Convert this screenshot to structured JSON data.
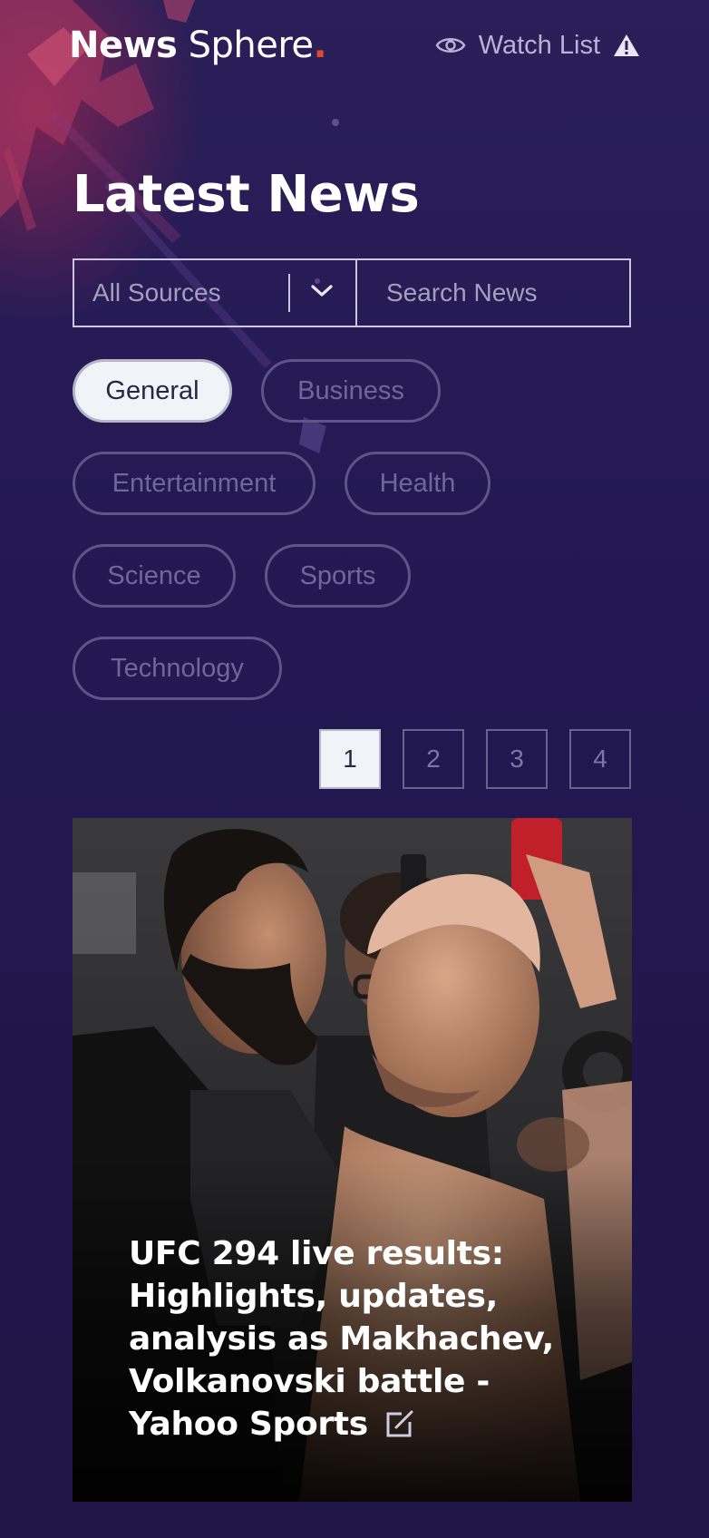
{
  "app": {
    "logo_bold": "News",
    "logo_light": " Sphere",
    "logo_dot": ".",
    "watch_list_label": "Watch List"
  },
  "page": {
    "title": "Latest News"
  },
  "filters": {
    "source_value": "All Sources",
    "search_placeholder": "Search News"
  },
  "categories": [
    {
      "label": "General",
      "active": true
    },
    {
      "label": "Business",
      "active": false
    },
    {
      "label": "Entertainment",
      "active": false
    },
    {
      "label": "Health",
      "active": false
    },
    {
      "label": "Science",
      "active": false
    },
    {
      "label": "Sports",
      "active": false
    },
    {
      "label": "Technology",
      "active": false
    }
  ],
  "pagination": {
    "pages": [
      "1",
      "2",
      "3",
      "4"
    ],
    "current": "1"
  },
  "article": {
    "headline": "UFC 294 live results: Highlights, updates, analysis as Makhachev, Volkanovski battle - Yahoo Sports",
    "icon": "external-link-icon"
  },
  "icons": {
    "watch": "eye-icon",
    "warning": "warning-icon",
    "dropdown": "chevron-down-icon"
  },
  "colors": {
    "background": "#211648",
    "accent_dot": "#e0472f",
    "chip_border": "#5e5488",
    "active_chip_bg": "#f2f3f8"
  }
}
